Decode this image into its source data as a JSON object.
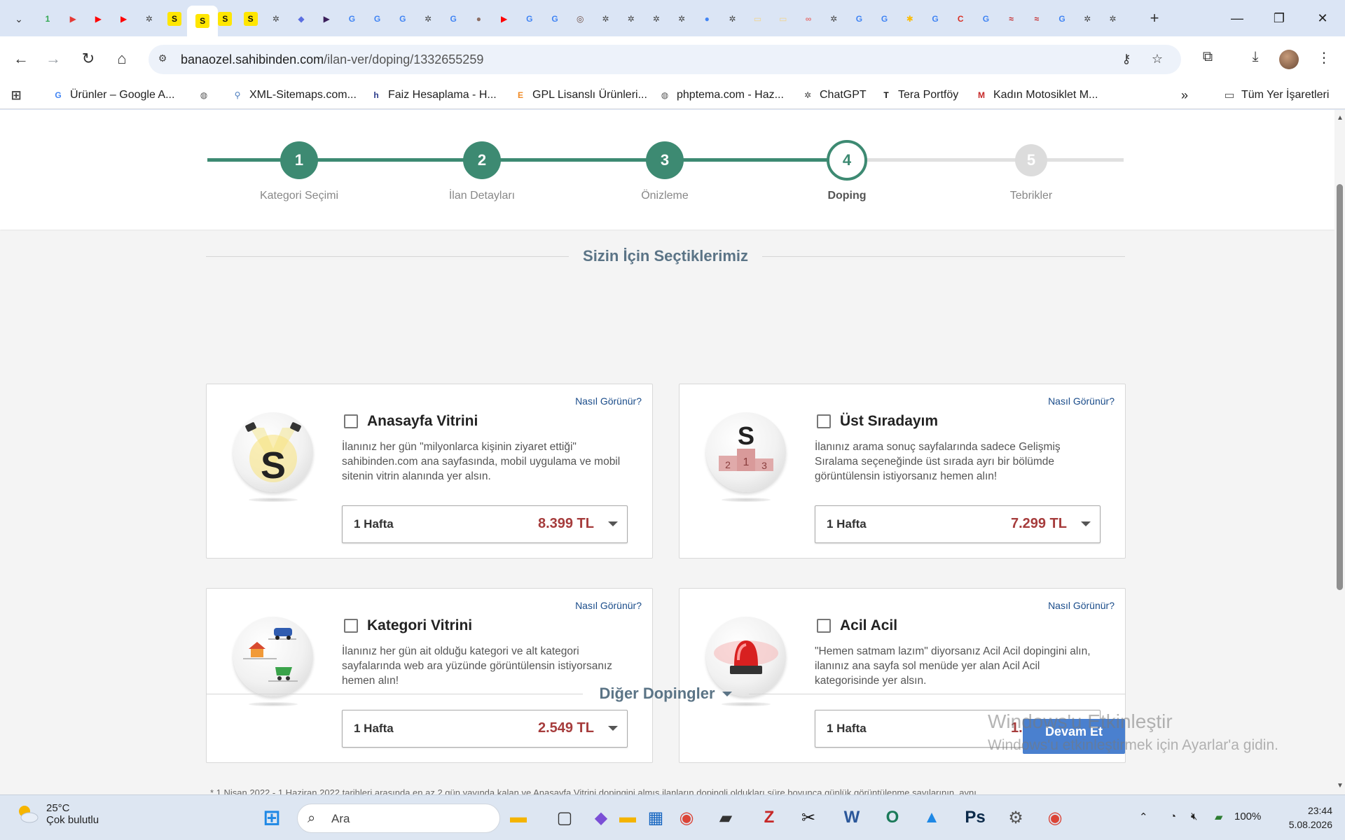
{
  "browser": {
    "tabs": [
      {
        "icon": "green-counter-icon",
        "label": "1",
        "color": "#34a853"
      },
      {
        "icon": "red-play-icon",
        "label": "▶",
        "color": "#e53935"
      },
      {
        "icon": "youtube-icon",
        "label": "▶",
        "color": "#ff0000"
      },
      {
        "icon": "youtube-icon",
        "label": "▶",
        "color": "#ff0000"
      },
      {
        "icon": "chatgpt-icon",
        "label": "✲",
        "color": "#444444"
      },
      {
        "icon": "sahibinden-icon",
        "label": "S",
        "color": "#ffe600"
      },
      {
        "icon": "sahibinden-icon",
        "label": "S",
        "color": "#ffe600"
      },
      {
        "icon": "sahibinden-icon",
        "label": "S",
        "color": "#ffe600"
      },
      {
        "icon": "sahibinden-icon",
        "label": "S",
        "color": "#ffe600"
      },
      {
        "icon": "chatgpt-icon",
        "label": "✲",
        "color": "#444444"
      },
      {
        "icon": "copilot-icon",
        "label": "◆",
        "color": "#5b6ee1"
      },
      {
        "icon": "purple-app-icon",
        "label": "▶",
        "color": "#3b1f5a"
      },
      {
        "icon": "google-icon",
        "label": "G",
        "color": "#4285f4"
      },
      {
        "icon": "google-icon",
        "label": "G",
        "color": "#4285f4"
      },
      {
        "icon": "google-icon",
        "label": "G",
        "color": "#4285f4"
      },
      {
        "icon": "chatgpt-icon",
        "label": "✲",
        "color": "#444444"
      },
      {
        "icon": "google-icon",
        "label": "G",
        "color": "#4285f4"
      },
      {
        "icon": "colorwheel-icon",
        "label": "●",
        "color": "#8d6e63"
      },
      {
        "icon": "youtube-icon",
        "label": "▶",
        "color": "#ff0000"
      },
      {
        "icon": "google-icon",
        "label": "G",
        "color": "#4285f4"
      },
      {
        "icon": "google-icon",
        "label": "G",
        "color": "#4285f4"
      },
      {
        "icon": "compass-icon",
        "label": "◎",
        "color": "#6d4c41"
      },
      {
        "icon": "chatgpt-icon",
        "label": "✲",
        "color": "#444444"
      },
      {
        "icon": "chatgpt-icon",
        "label": "✲",
        "color": "#444444"
      },
      {
        "icon": "chatgpt-icon",
        "label": "✲",
        "color": "#444444"
      },
      {
        "icon": "chatgpt-icon",
        "label": "✲",
        "color": "#444444"
      },
      {
        "icon": "google-dots-icon",
        "label": "●",
        "color": "#4285f4"
      },
      {
        "icon": "chatgpt-icon",
        "label": "✲",
        "color": "#444444"
      },
      {
        "icon": "folder-light-icon",
        "label": "▭",
        "color": "#f2d48a"
      },
      {
        "icon": "folder-light-icon",
        "label": "▭",
        "color": "#f2d48a"
      },
      {
        "icon": "knot-icon",
        "label": "∞",
        "color": "#e57373"
      },
      {
        "icon": "chatgpt-icon",
        "label": "✲",
        "color": "#444444"
      },
      {
        "icon": "google-icon",
        "label": "G",
        "color": "#4285f4"
      },
      {
        "icon": "google-icon",
        "label": "G",
        "color": "#4285f4"
      },
      {
        "icon": "pinwheel-icon",
        "label": "✱",
        "color": "#fbbc05"
      },
      {
        "icon": "google-icon",
        "label": "G",
        "color": "#4285f4"
      },
      {
        "icon": "red-box-icon",
        "label": "C",
        "color": "#d93025"
      },
      {
        "icon": "google-icon",
        "label": "G",
        "color": "#4285f4"
      },
      {
        "icon": "byd-icon",
        "label": "≈",
        "color": "#c62828"
      },
      {
        "icon": "byd-icon",
        "label": "≈",
        "color": "#c62828"
      },
      {
        "icon": "google-icon",
        "label": "G",
        "color": "#4285f4"
      },
      {
        "icon": "chatgpt-icon",
        "label": "✲",
        "color": "#444444"
      },
      {
        "icon": "chatgpt-icon",
        "label": "✲",
        "color": "#444444"
      }
    ],
    "active_tab_index": 6,
    "url_host": "banaozel.sahibinden.com",
    "url_path": "/ilan-ver/doping/1332655259",
    "bookmarks": [
      {
        "label": "Ürünler – Google A...",
        "icon": "google-icon",
        "icon_text": "G",
        "color": "#4285f4"
      },
      {
        "label": "",
        "icon": "globe-icon",
        "icon_text": "◍",
        "color": "#555555"
      },
      {
        "label": "XML-Sitemaps.com...",
        "icon": "sitemap-icon",
        "icon_text": "⚲",
        "color": "#4a7bbd"
      },
      {
        "label": "Faiz Hesaplama - H...",
        "icon": "hesapkurdu-icon",
        "icon_text": "h",
        "color": "#2a3a8a"
      },
      {
        "label": "GPL Lisanslı Ürünleri...",
        "icon": "gpl-icon",
        "icon_text": "E",
        "color": "#f08a24"
      },
      {
        "label": "phptema.com - Haz...",
        "icon": "globe-icon",
        "icon_text": "◍",
        "color": "#555555"
      },
      {
        "label": "ChatGPT",
        "icon": "chatgpt-icon",
        "icon_text": "✲",
        "color": "#444444"
      },
      {
        "label": "Tera Portföy",
        "icon": "tera-icon",
        "icon_text": "T",
        "color": "#111111"
      },
      {
        "label": "Kadın Motosiklet M...",
        "icon": "m-icon",
        "icon_text": "M",
        "color": "#c62828"
      }
    ],
    "bookmarks_folder": "Tüm Yer İşaretleri"
  },
  "stepper": {
    "steps": [
      {
        "num": "1",
        "label": "Kategori Seçimi"
      },
      {
        "num": "2",
        "label": "İlan Detayları"
      },
      {
        "num": "3",
        "label": "Önizleme"
      },
      {
        "num": "4",
        "label": "Doping"
      },
      {
        "num": "5",
        "label": "Tebrikler"
      }
    ],
    "current_step": 4
  },
  "section_title": "Sizin İçin Seçtiklerimiz",
  "how_link": "Nasıl Görünür?",
  "cards": [
    {
      "title": "Anasayfa Vitrini",
      "icon": "homepage-showcase-icon",
      "description": "İlanınız her gün \"milyonlarca kişinin ziyaret ettiği\" sahibinden.com ana sayfasında, mobil uygulama ve mobil sitenin vitrin alanında yer alsın.",
      "duration": "1 Hafta",
      "price": "8.399 TL",
      "checked": false
    },
    {
      "title": "Üst Sıradayım",
      "icon": "podium-icon",
      "description": "İlanınız arama sonuç sayfalarında sadece Gelişmiş Sıralama seçeneğinde üst sırada ayrı bir bölümde görüntülensin istiyorsanız hemen alın!",
      "duration": "1 Hafta",
      "price": "7.299 TL",
      "checked": false
    },
    {
      "title": "Kategori Vitrini",
      "icon": "category-showcase-icon",
      "description": "İlanınız her gün ait olduğu kategori ve alt kategori sayfalarında web ara yüzünde görüntülensin istiyorsanız hemen alın!",
      "duration": "1 Hafta",
      "price": "2.549 TL",
      "checked": false
    },
    {
      "title": "Acil Acil",
      "icon": "siren-icon",
      "description": "\"Hemen satmam lazım\" diyorsanız Acil Acil dopingini alın, ilanınız ana sayfa sol menüde yer alan Acil Acil kategorisinde yer alsın.",
      "duration": "1 Hafta",
      "price": "1.999 TL",
      "checked": false
    }
  ],
  "other_dopings": "Diğer Dopingler",
  "continue_button": "Devam Et",
  "watermark": {
    "line1": "Windows'u Etkinleştir",
    "line2": "Windows'u etkinleştirmek için Ayarlar'a gidin."
  },
  "footnote": "* 1 Nisan 2022 - 1 Haziran 2022 tarihleri arasında en az 2 gün yayında kalan ve Anasayfa Vitrini dopingini almış ilanların dopingli oldukları süre boyunca günlük görüntülenme sayılarının, aynı",
  "taskbar": {
    "weather_temp": "25°C",
    "weather_desc": "Çok bulutlu",
    "search_placeholder": "Ara",
    "battery": "100%",
    "time": "23:44",
    "date": "5.08.2026",
    "apps": [
      {
        "name": "windows-start-icon",
        "glyph": "⊞",
        "color": "#1e88e5"
      },
      {
        "name": "file-explorer-icon",
        "glyph": "▬",
        "color": "#f4b400"
      },
      {
        "name": "task-view-icon",
        "glyph": "▢",
        "color": "#333333"
      },
      {
        "name": "m365-icon",
        "glyph": "◆",
        "color": "#7b4fd6"
      },
      {
        "name": "folder-icon",
        "glyph": "▬",
        "color": "#f4b400"
      },
      {
        "name": "store-icon",
        "glyph": "▦",
        "color": "#1565c0"
      },
      {
        "name": "chrome-icon",
        "glyph": "◉",
        "color": "#db4437"
      },
      {
        "name": "notes-icon",
        "glyph": "▰",
        "color": "#333333"
      },
      {
        "name": "filezilla-icon",
        "glyph": "Z",
        "color": "#c62828"
      },
      {
        "name": "capcut-icon",
        "glyph": "✂",
        "color": "#111111"
      },
      {
        "name": "word-icon",
        "glyph": "W",
        "color": "#2b579a"
      },
      {
        "name": "opera-icon",
        "glyph": "O",
        "color": "#1b7a5a"
      },
      {
        "name": "photos-icon",
        "glyph": "▲",
        "color": "#1e88e5"
      },
      {
        "name": "photoshop-icon",
        "glyph": "Ps",
        "color": "#0b2a4a"
      },
      {
        "name": "settings-icon",
        "glyph": "⚙",
        "color": "#555555"
      },
      {
        "name": "chrome-icon",
        "glyph": "◉",
        "color": "#db4437"
      }
    ]
  }
}
